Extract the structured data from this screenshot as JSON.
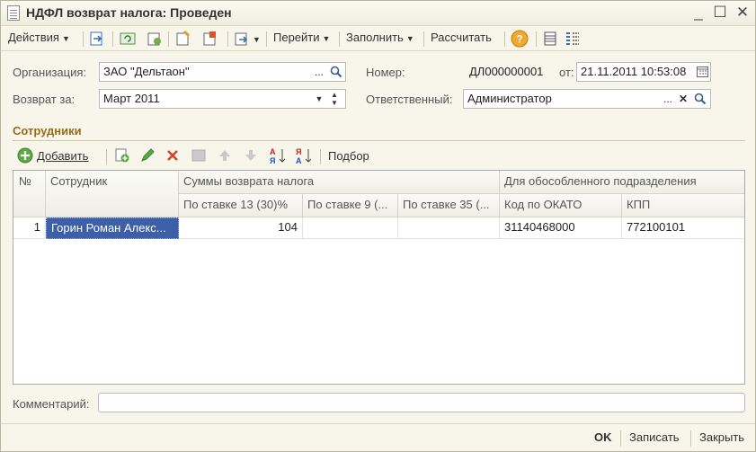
{
  "window": {
    "title": "НДФЛ возврат налога: Проведен"
  },
  "toolbar": {
    "actions": "Действия",
    "goto": "Перейти",
    "fill": "Заполнить",
    "calculate": "Рассчитать",
    "help_symbol": "?"
  },
  "form": {
    "org_label": "Организация:",
    "org_value": "ЗАО \"Дельтаон\"",
    "number_label": "Номер:",
    "number_value": "ДЛ000000001",
    "date_label": "от:",
    "date_value": "21.11.2011 10:53:08",
    "return_for_label": "Возврат за:",
    "return_for_value": "Март 2011",
    "responsible_label": "Ответственный:",
    "responsible_value": "Администратор"
  },
  "employees": {
    "title": "Сотрудники",
    "add_label": "Добавить",
    "selection_label": "Подбор",
    "headers": {
      "num": "№",
      "employee": "Сотрудник",
      "sums_group": "Суммы возврата налога",
      "rate13": "По ставке 13 (30)%",
      "rate9": "По ставке 9 (...",
      "rate35": "По ставке 35 (...",
      "branch_group": "Для обособленного подразделения",
      "okato": "Код по ОКАТО",
      "kpp": "КПП"
    },
    "rows": [
      {
        "num": "1",
        "employee": "Горин Роман Алекс...",
        "rate13": "104",
        "rate9": "",
        "rate35": "",
        "okato": "31140468000",
        "kpp": "772100101"
      }
    ]
  },
  "comment": {
    "label": "Комментарий:",
    "value": ""
  },
  "footer": {
    "ok": "OK",
    "save": "Записать",
    "close": "Закрыть"
  },
  "colors": {
    "section_title": "#9b6a18",
    "selected_cell": "#3d5fa8",
    "window_bg": "#f8f6ea"
  }
}
